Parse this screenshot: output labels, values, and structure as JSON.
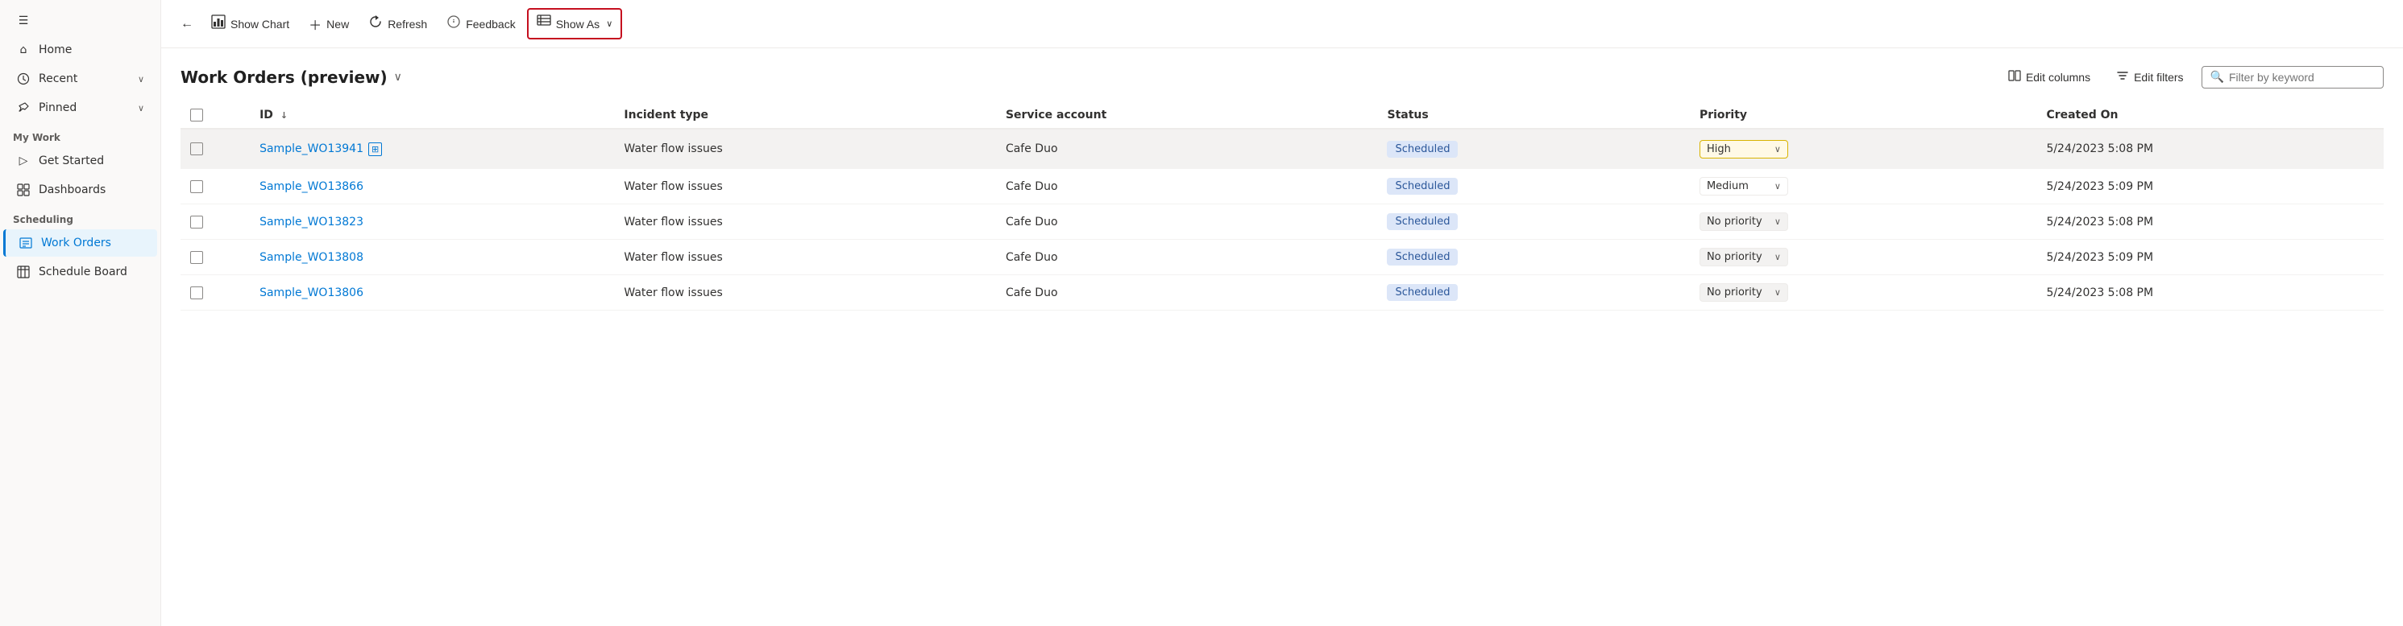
{
  "sidebar": {
    "items": [
      {
        "id": "home",
        "label": "Home",
        "icon": "🏠",
        "hasChevron": false
      },
      {
        "id": "recent",
        "label": "Recent",
        "icon": "🕐",
        "hasChevron": true
      },
      {
        "id": "pinned",
        "label": "Pinned",
        "icon": "📌",
        "hasChevron": true
      }
    ],
    "mywork_title": "My Work",
    "mywork_items": [
      {
        "id": "get-started",
        "label": "Get Started",
        "icon": "▷"
      },
      {
        "id": "dashboards",
        "label": "Dashboards",
        "icon": "⊞"
      }
    ],
    "scheduling_title": "Scheduling",
    "scheduling_items": [
      {
        "id": "work-orders",
        "label": "Work Orders",
        "icon": "📋",
        "active": true
      },
      {
        "id": "schedule-board",
        "label": "Schedule Board",
        "icon": "📅"
      }
    ]
  },
  "toolbar": {
    "back_label": "←",
    "show_chart_label": "Show Chart",
    "new_label": "New",
    "refresh_label": "Refresh",
    "feedback_label": "Feedback",
    "show_as_label": "Show As"
  },
  "page": {
    "title": "Work Orders (preview)",
    "edit_columns_label": "Edit columns",
    "edit_filters_label": "Edit filters",
    "filter_placeholder": "Filter by keyword"
  },
  "table": {
    "columns": [
      {
        "id": "id",
        "label": "ID",
        "sortable": true
      },
      {
        "id": "incident_type",
        "label": "Incident type"
      },
      {
        "id": "service_account",
        "label": "Service account"
      },
      {
        "id": "status",
        "label": "Status"
      },
      {
        "id": "priority",
        "label": "Priority"
      },
      {
        "id": "created_on",
        "label": "Created On"
      }
    ],
    "rows": [
      {
        "id": "Sample_WO13941",
        "incident_type": "Water flow issues",
        "service_account": "Cafe Duo",
        "status": "Scheduled",
        "priority": "High",
        "priority_class": "high",
        "created_on": "5/24/2023 5:08 PM",
        "highlighted": true
      },
      {
        "id": "Sample_WO13866",
        "incident_type": "Water flow issues",
        "service_account": "Cafe Duo",
        "status": "Scheduled",
        "priority": "Medium",
        "priority_class": "medium",
        "created_on": "5/24/2023 5:09 PM",
        "highlighted": false
      },
      {
        "id": "Sample_WO13823",
        "incident_type": "Water flow issues",
        "service_account": "Cafe Duo",
        "status": "Scheduled",
        "priority": "No priority",
        "priority_class": "no-priority",
        "created_on": "5/24/2023 5:08 PM",
        "highlighted": false
      },
      {
        "id": "Sample_WO13808",
        "incident_type": "Water flow issues",
        "service_account": "Cafe Duo",
        "status": "Scheduled",
        "priority": "No priority",
        "priority_class": "no-priority",
        "created_on": "5/24/2023 5:09 PM",
        "highlighted": false
      },
      {
        "id": "Sample_WO13806",
        "incident_type": "Water flow issues",
        "service_account": "Cafe Duo",
        "status": "Scheduled",
        "priority": "No priority",
        "priority_class": "no-priority",
        "created_on": "5/24/2023 5:08 PM",
        "highlighted": false
      }
    ]
  }
}
